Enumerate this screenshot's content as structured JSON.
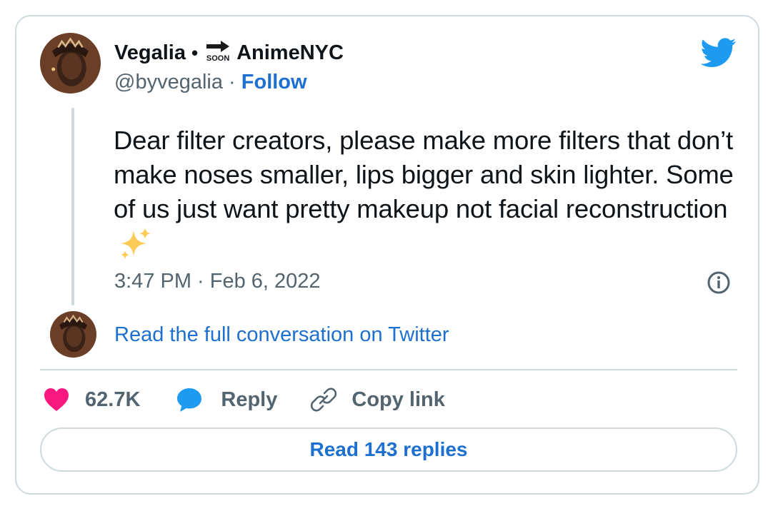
{
  "author": {
    "name": "Vegalia",
    "separator": "•",
    "badge_text": "SOON",
    "name_suffix": "AnimeNYC",
    "handle": "@byvegalia",
    "handle_sep": "·",
    "follow_label": "Follow"
  },
  "tweet": {
    "text": "Dear filter creators, please make more filters that don’t make noses smaller, lips bigger and skin lighter. Some of us just want pretty makeup not facial reconstruction",
    "emoji": "sparkles-emoji",
    "timestamp": "3:47 PM · Feb 6, 2022"
  },
  "conversation": {
    "read_full": "Read the full conversation on Twitter"
  },
  "actions": {
    "like_count": "62.7K",
    "reply_label": "Reply",
    "copy_link_label": "Copy link",
    "read_replies": "Read 143 replies"
  },
  "icons": {
    "brand": "twitter-bird-icon",
    "info": "info-icon",
    "like": "heart-icon",
    "reply": "speech-bubble-icon",
    "copy": "link-icon"
  },
  "colors": {
    "link_blue": "#1d6fd0",
    "twitter_blue": "#1d9bf0",
    "heart_pink": "#f91880",
    "muted_text": "#536471",
    "border": "#cfd9de"
  }
}
